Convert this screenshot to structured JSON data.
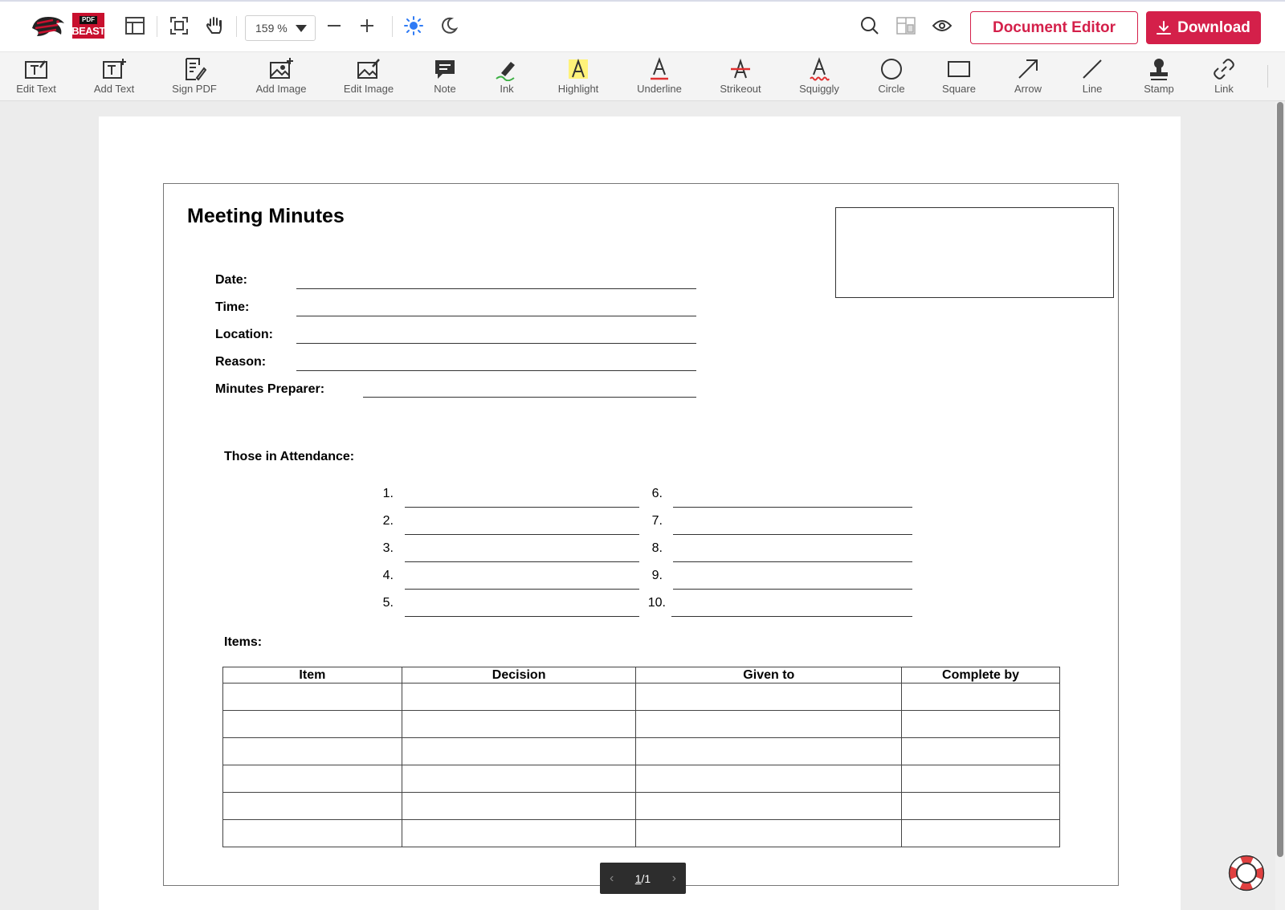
{
  "toolbar": {
    "logo_pdf": "PDF",
    "logo_text": "BEAST",
    "zoom_value": "159 %",
    "document_editor_label": "Document Editor",
    "download_label": "Download"
  },
  "tools": [
    {
      "label": "Edit Text",
      "icon": "edit-text-icon"
    },
    {
      "label": "Add Text",
      "icon": "add-text-icon"
    },
    {
      "label": "Sign PDF",
      "icon": "sign-pdf-icon"
    },
    {
      "label": "Add Image",
      "icon": "add-image-icon"
    },
    {
      "label": "Edit Image",
      "icon": "edit-image-icon"
    },
    {
      "label": "Note",
      "icon": "note-icon"
    },
    {
      "label": "Ink",
      "icon": "ink-icon"
    },
    {
      "label": "Highlight",
      "icon": "highlight-icon"
    },
    {
      "label": "Underline",
      "icon": "underline-icon"
    },
    {
      "label": "Strikeout",
      "icon": "strikeout-icon"
    },
    {
      "label": "Squiggly",
      "icon": "squiggly-icon"
    },
    {
      "label": "Circle",
      "icon": "circle-icon"
    },
    {
      "label": "Square",
      "icon": "square-icon"
    },
    {
      "label": "Arrow",
      "icon": "arrow-icon"
    },
    {
      "label": "Line",
      "icon": "line-icon"
    },
    {
      "label": "Stamp",
      "icon": "stamp-icon"
    },
    {
      "label": "Link",
      "icon": "link-icon"
    }
  ],
  "document": {
    "title": "Meeting Minutes",
    "fields": [
      "Date:",
      "Time:",
      "Location:",
      "Reason:",
      "Minutes Preparer:"
    ],
    "attendance_label": "Those in Attendance:",
    "attendance_numbers": [
      "1.",
      "2.",
      "3.",
      "4.",
      "5.",
      "6.",
      "7.",
      "8.",
      "9.",
      "10."
    ],
    "items_label": "Items:",
    "table_headers": [
      "Item",
      "Decision",
      "Given to",
      "Complete by"
    ]
  },
  "pager": {
    "current": "1",
    "total": "/1"
  },
  "colors": {
    "accent": "#d4204a",
    "sun_active": "#2f7bf5",
    "highlight": "#fff27a"
  }
}
